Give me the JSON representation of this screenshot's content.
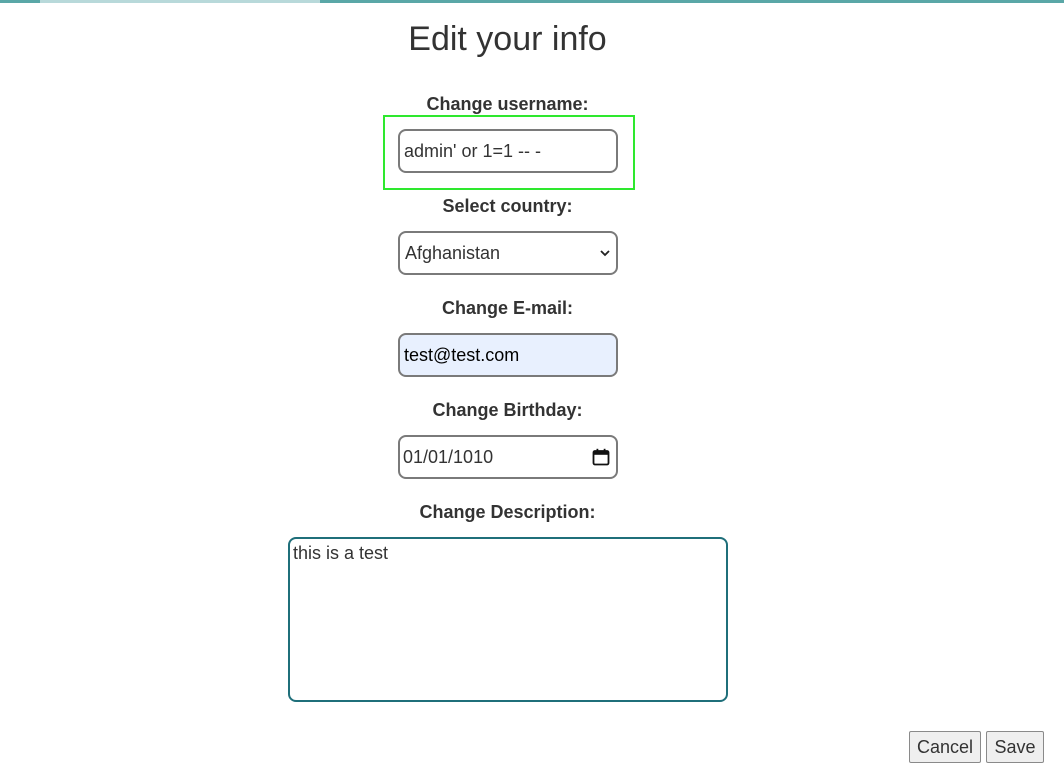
{
  "form": {
    "title": "Edit your info",
    "username": {
      "label": "Change username:",
      "value": "admin' or 1=1 -- -"
    },
    "country": {
      "label": "Select country:",
      "selected": "Afghanistan"
    },
    "email": {
      "label": "Change E-mail:",
      "value": "test@test.com"
    },
    "birthday": {
      "label": "Change Birthday:",
      "value": "01/01/1010"
    },
    "description": {
      "label": "Change Description:",
      "value": "this is a test"
    },
    "buttons": {
      "cancel": "Cancel",
      "save": "Save"
    }
  },
  "colors": {
    "highlight": "#2ee82e",
    "autofill_background": "#e8f0fe",
    "textarea_border": "#1f6f7a"
  },
  "icons": {
    "country_dropdown": "chevron-down-icon",
    "birthday_picker": "calendar-icon"
  }
}
